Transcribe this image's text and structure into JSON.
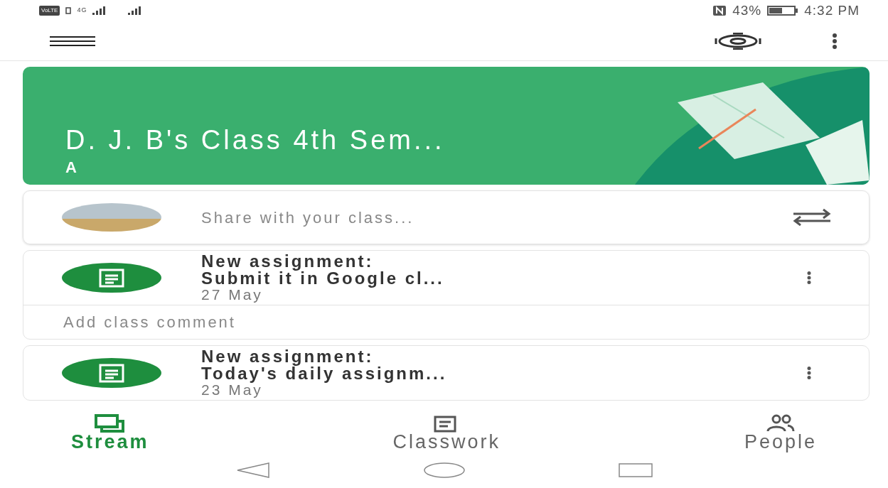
{
  "status_bar": {
    "volte": "VoLTE",
    "network": "4G",
    "battery": "43%",
    "time": "4:32 PM"
  },
  "class_banner": {
    "title": "D. J. B's Class 4th Sem...",
    "section": "A"
  },
  "share_box": {
    "placeholder": "Share with your class..."
  },
  "posts": [
    {
      "title": "New assignment:",
      "subtitle": "Submit it in Google cl...",
      "date": "27 May",
      "comment_placeholder": "Add class comment"
    },
    {
      "title": "New assignment:",
      "subtitle": "Today's daily assignm...",
      "date": "23 May"
    }
  ],
  "bottom_nav": [
    {
      "label": "Stream",
      "kind": "stream",
      "selected": true
    },
    {
      "label": "Classwork",
      "kind": "classwork",
      "selected": false
    },
    {
      "label": "People",
      "kind": "people",
      "selected": false
    }
  ]
}
